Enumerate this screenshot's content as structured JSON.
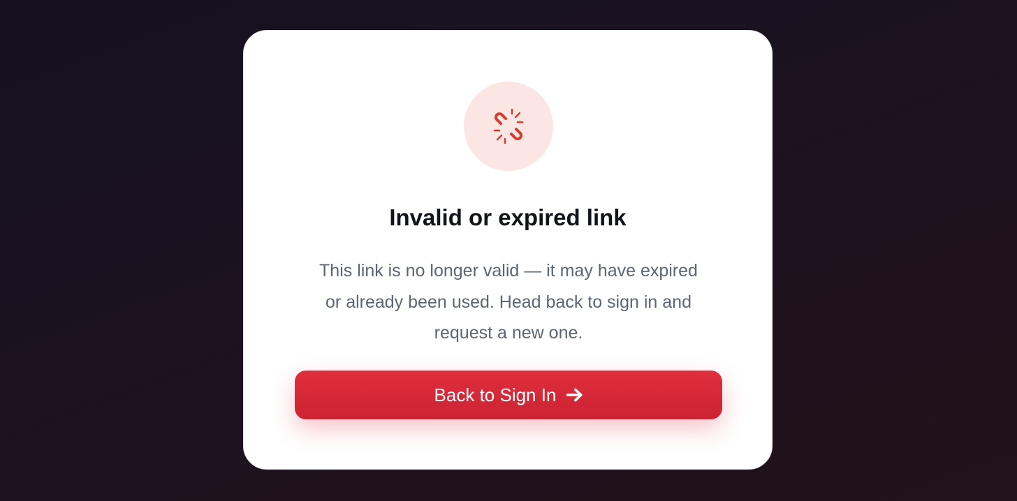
{
  "card": {
    "icon": "broken-link-icon",
    "title": "Invalid or expired link",
    "message": "This link is no longer valid — it may have expired or already been used. Head back to sign in and request a new one.",
    "button": {
      "label": "Back to Sign In",
      "icon": "arrow-right-icon"
    }
  },
  "colors": {
    "accent": "#d92a38",
    "icon_bg": "#fbe6e3",
    "icon_fg": "#d93a2f",
    "title": "#111418",
    "body_text": "#5d6575"
  }
}
